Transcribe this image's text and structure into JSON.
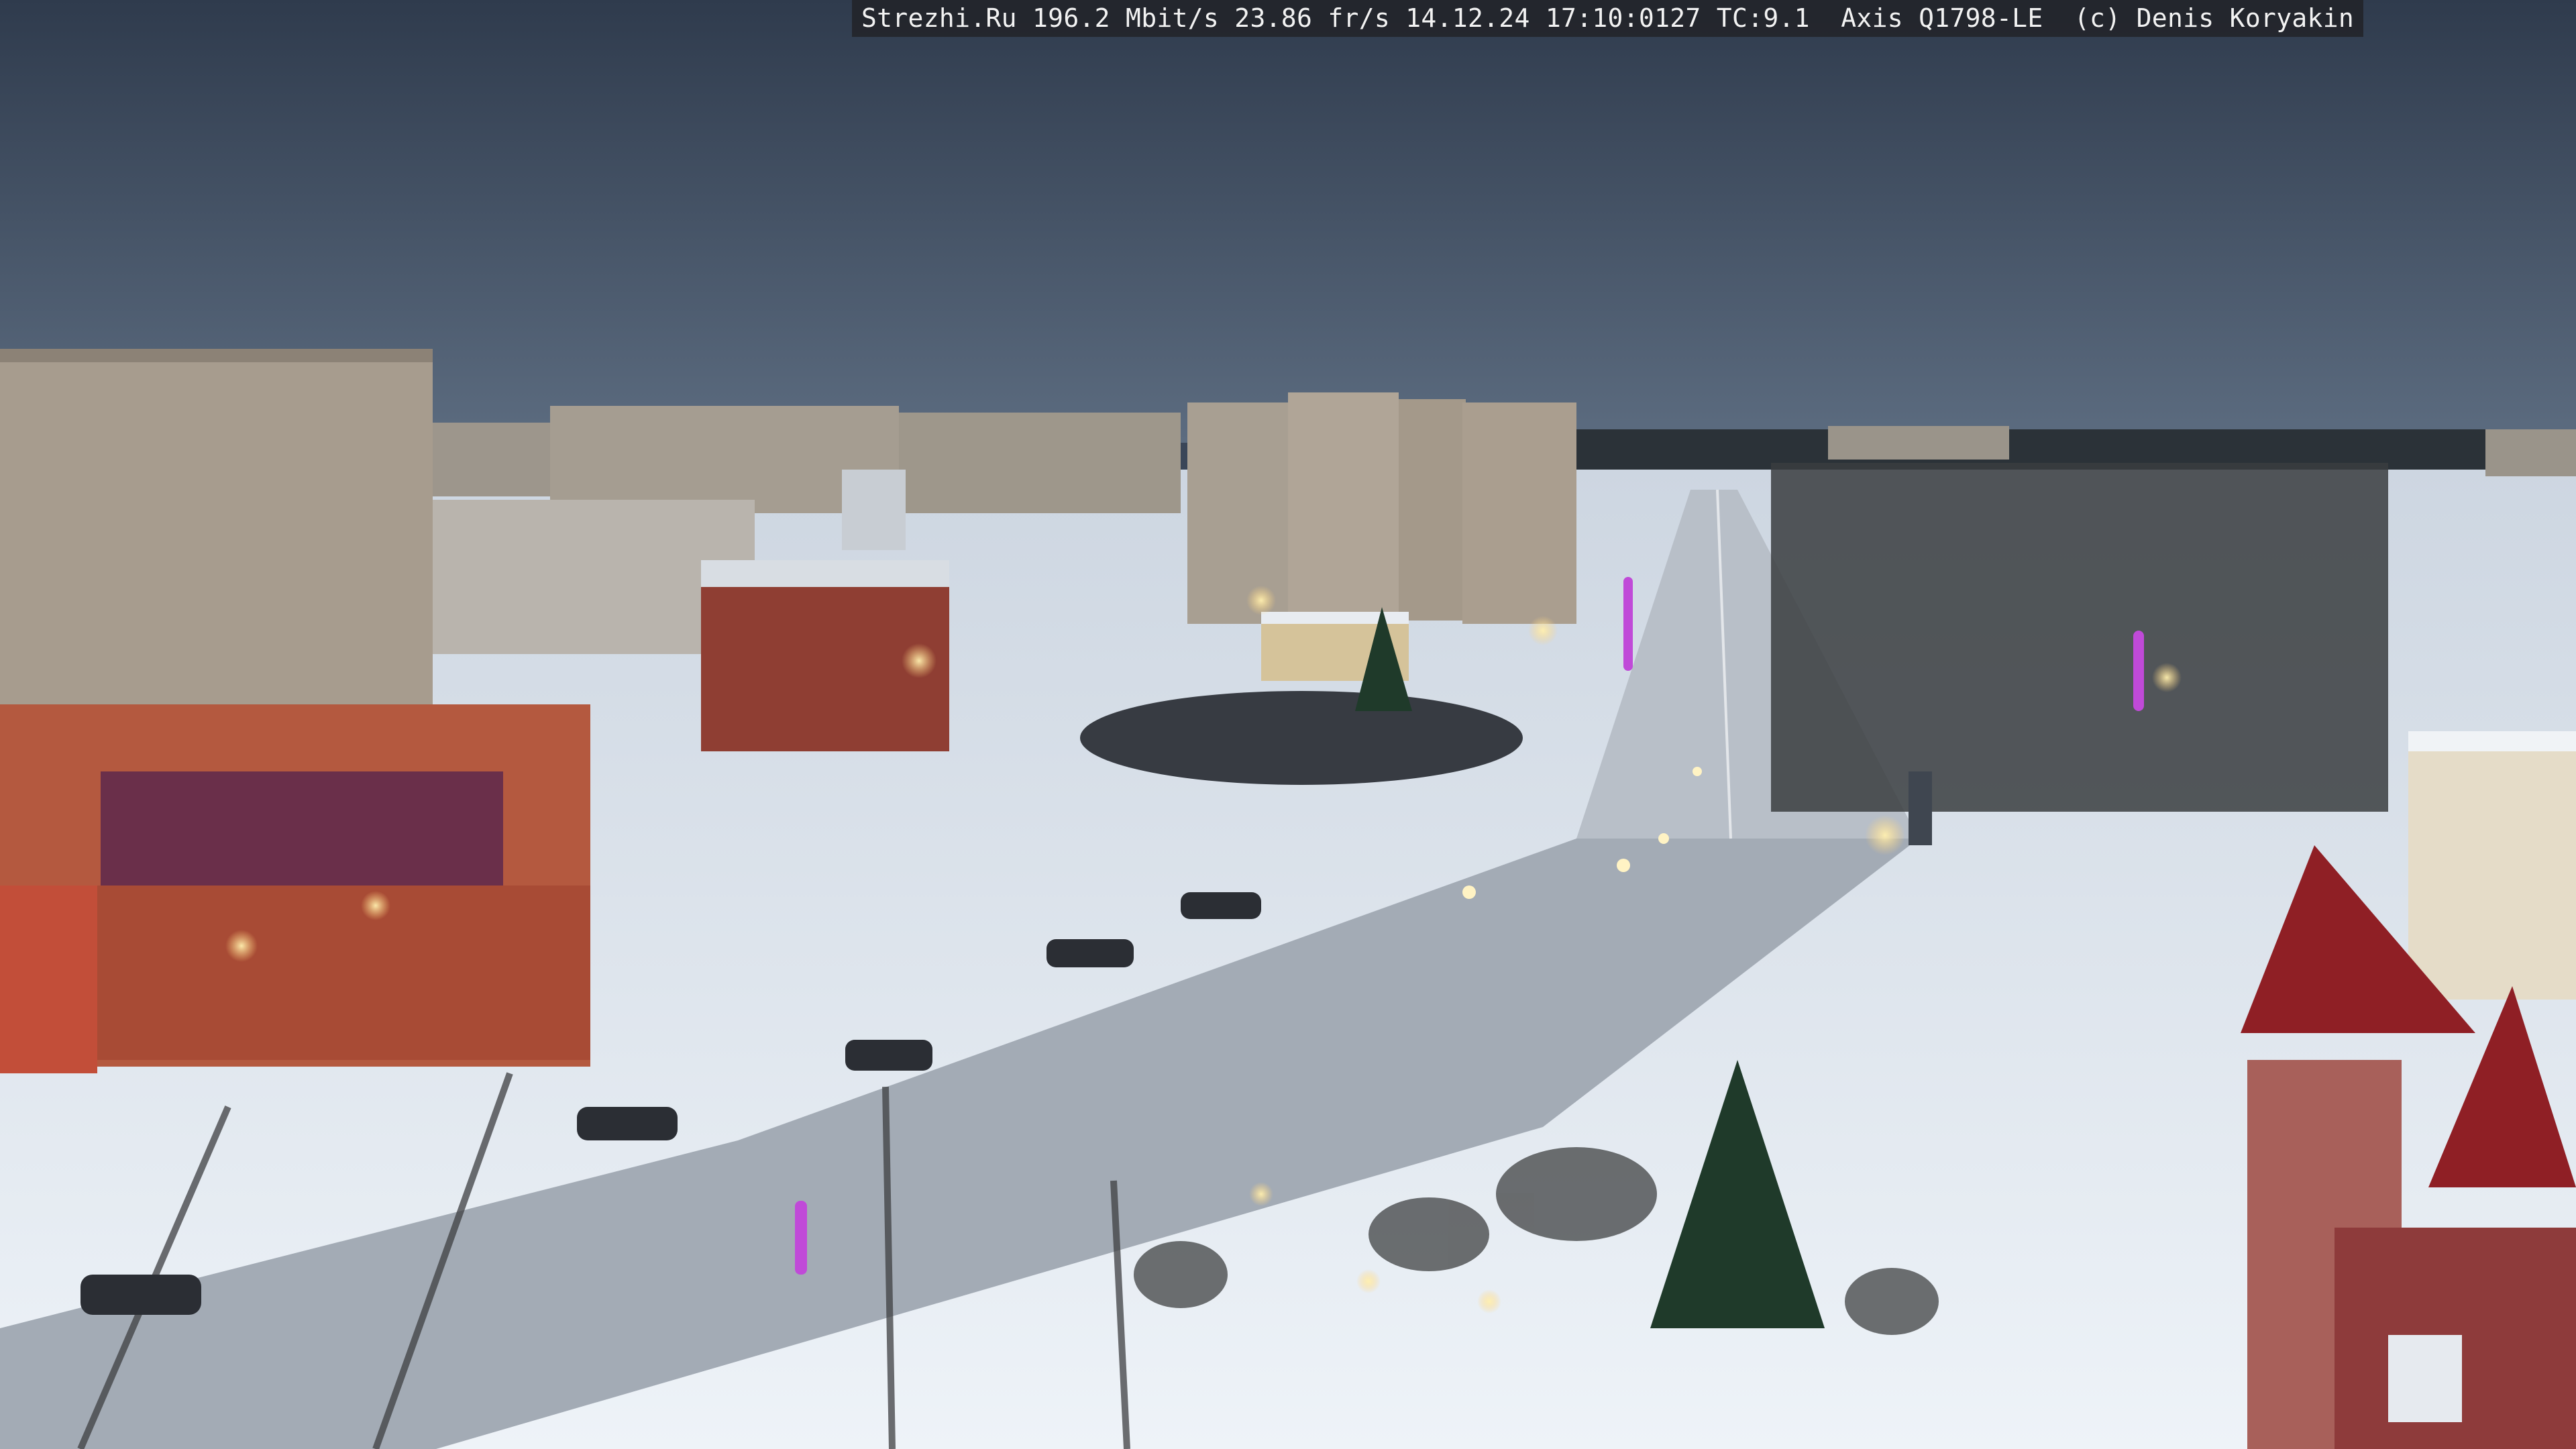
{
  "overlay": {
    "text": "Strezhi.Ru 196.2 Mbit/s 23.86 fr/s 14.12.24 17:10:0127 TC:9.1  Axis Q1798-LE  (c) Denis Koryakin"
  },
  "scene": {
    "sky_top": "#2f3b4d",
    "sky_horizon": "#5c6c80",
    "snow": "#e6edf5",
    "snow_shadow": "#c7d2df",
    "road": "#9aa2ad",
    "building_panel": "#a79c8e",
    "building_brick": "#b4593f",
    "tree_dark": "#2a2f33",
    "spruce": "#1f3a2a",
    "crowd": "#1b1e24",
    "light_warm": "#ffd27a",
    "light_neon": "#c04ad8",
    "roof_red": "#8f1f25"
  }
}
